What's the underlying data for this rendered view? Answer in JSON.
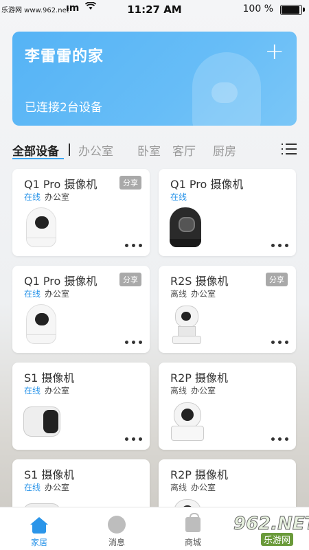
{
  "status_bar": {
    "watermark": "乐游网 www.962.net",
    "carrier_tail": "ım",
    "time": "11:27 AM",
    "battery_text": "100 %",
    "battery_level": 1.0
  },
  "banner": {
    "title": "李雷雷的家",
    "add_icon": "plus-icon",
    "subtitle": "已连接2台设备"
  },
  "tabs": {
    "items": [
      "全部设备",
      "办公室",
      "卧室",
      "客厅",
      "厨房"
    ],
    "active_index": 0,
    "menu_icon": "list-menu-icon"
  },
  "devices": [
    {
      "name": "Q1 Pro 摄像机",
      "state": "在线",
      "room": "办公室",
      "share": "分享",
      "image": "egg-white-camera"
    },
    {
      "name": "Q1 Pro 摄像机",
      "state": "在线",
      "room": "",
      "share": "",
      "image": "egg-black-camera"
    },
    {
      "name": "Q1 Pro 摄像机",
      "state": "在线",
      "room": "办公室",
      "share": "分享",
      "image": "egg-white-camera"
    },
    {
      "name": "R2S 摄像机",
      "state": "离线",
      "room": "办公室",
      "share": "分享",
      "image": "pan-tilt-camera"
    },
    {
      "name": "S1 摄像机",
      "state": "在线",
      "room": "办公室",
      "share": "",
      "image": "battery-camera"
    },
    {
      "name": "R2P 摄像机",
      "state": "离线",
      "room": "办公室",
      "share": "",
      "image": "dome-camera"
    },
    {
      "name": "S1 摄像机",
      "state": "在线",
      "room": "办公室",
      "share": "",
      "image": "battery-camera"
    },
    {
      "name": "R2P 摄像机",
      "state": "离线",
      "room": "办公室",
      "share": "",
      "image": "dome-camera"
    }
  ],
  "tabbar": {
    "items": [
      {
        "label": "家居",
        "icon": "home-icon"
      },
      {
        "label": "消息",
        "icon": "message-icon"
      },
      {
        "label": "商城",
        "icon": "shop-bag-icon"
      }
    ],
    "active_index": 0
  },
  "watermark": {
    "number": "962",
    "suffix": ".NET",
    "text": "乐游网"
  },
  "colors": {
    "accent": "#2b95e9",
    "banner": "#5fb8f6",
    "offline": "#555555"
  }
}
